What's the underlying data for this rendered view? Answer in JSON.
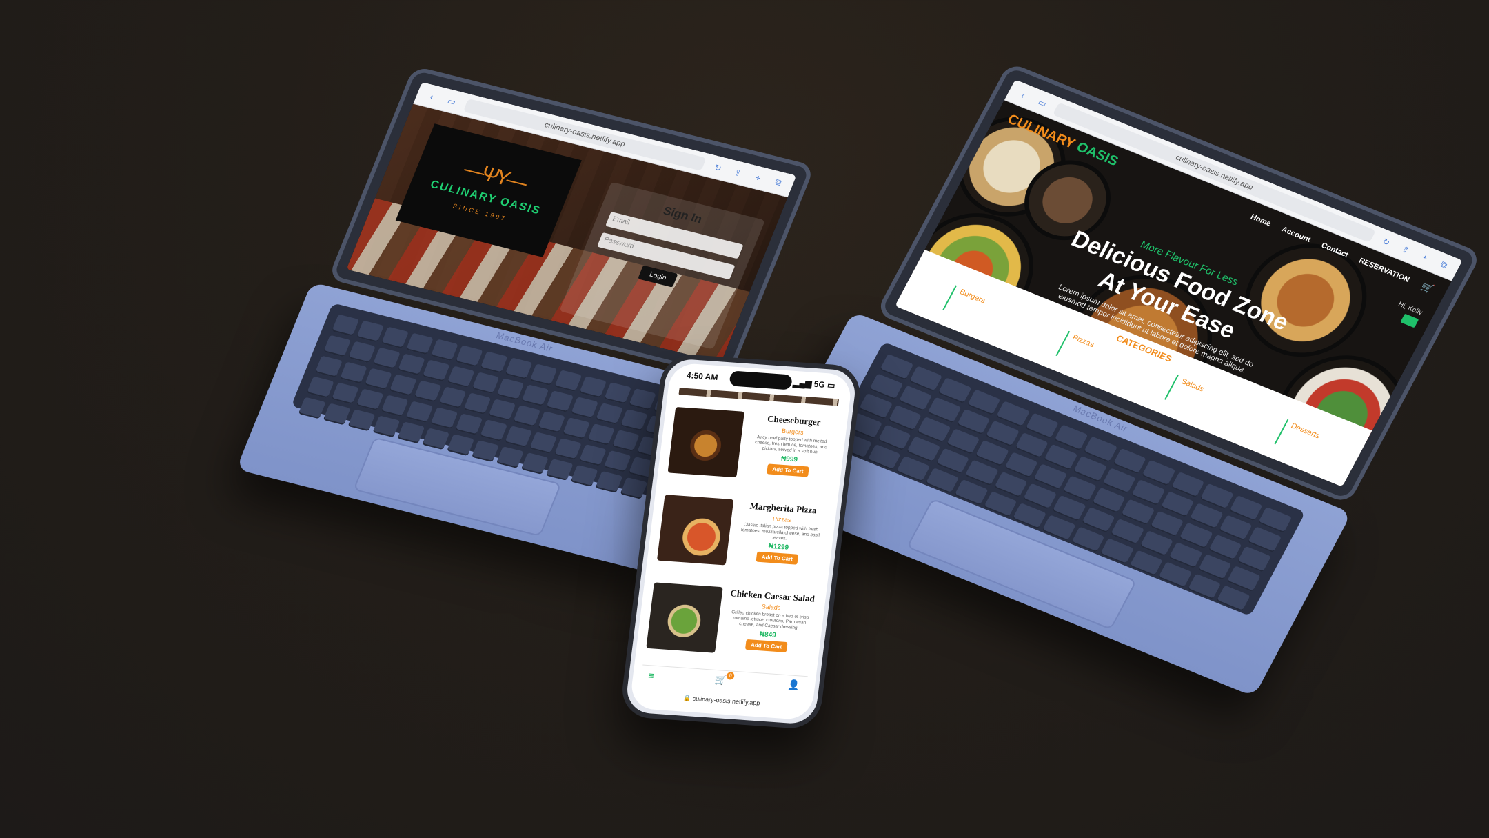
{
  "left_laptop": {
    "browser": {
      "url": "culinary-oasis.netlify.app"
    },
    "logo": {
      "title": "CULINARY OASIS",
      "subtitle": "SINCE 1997"
    },
    "signin": {
      "title": "Sign In",
      "email_placeholder": "Email",
      "password_placeholder": "Password",
      "button": "Login"
    },
    "brand": "MacBook Air"
  },
  "right_laptop": {
    "browser": {
      "url": "culinary-oasis.netlify.app"
    },
    "brand_part1": "CULINARY",
    "brand_part2": "OASIS",
    "nav": [
      "Home",
      "Account",
      "Contact",
      "RESERVATION"
    ],
    "greeting": "Hi, Kelly",
    "hero": {
      "tag": "More Flavour For Less",
      "title_line1": "Delicious Food Zone",
      "title_line2": "At Your Ease",
      "body": "Lorem ipsum dolor sit amet, consectetur adipiscing elit, sed do eiusmod tempor incididunt ut labore et dolore magna aliqua."
    },
    "categories_title": "CATEGORIES",
    "categories": [
      "Burgers",
      "Pizzas",
      "Salads",
      "Desserts"
    ],
    "brand": "MacBook Air"
  },
  "phone": {
    "time": "4:50 AM",
    "signal": "5G",
    "items": [
      {
        "name": "Cheeseburger",
        "category": "Burgers",
        "description": "Juicy beef patty topped with melted cheese, fresh lettuce, tomatoes, and pickles, served in a soft bun.",
        "price": "₦999",
        "button": "Add To Cart"
      },
      {
        "name": "Margherita Pizza",
        "category": "Pizzas",
        "description": "Classic Italian pizza topped with fresh tomatoes, mozzarella cheese, and basil leaves.",
        "price": "₦1299",
        "button": "Add To Cart"
      },
      {
        "name": "Chicken Caesar Salad",
        "category": "Salads",
        "description": "Grilled chicken breast on a bed of crisp romaine lettuce, croutons, Parmesan cheese, and Caesar dressing.",
        "price": "₦849",
        "button": "Add To Cart"
      }
    ],
    "cart_count": "0",
    "url": "culinary-oasis.netlify.app"
  },
  "colors": {
    "accent_orange": "#f28c1b",
    "accent_green": "#1fc06a",
    "laptop_base": "#8fa2d4",
    "background": "#231e19"
  }
}
